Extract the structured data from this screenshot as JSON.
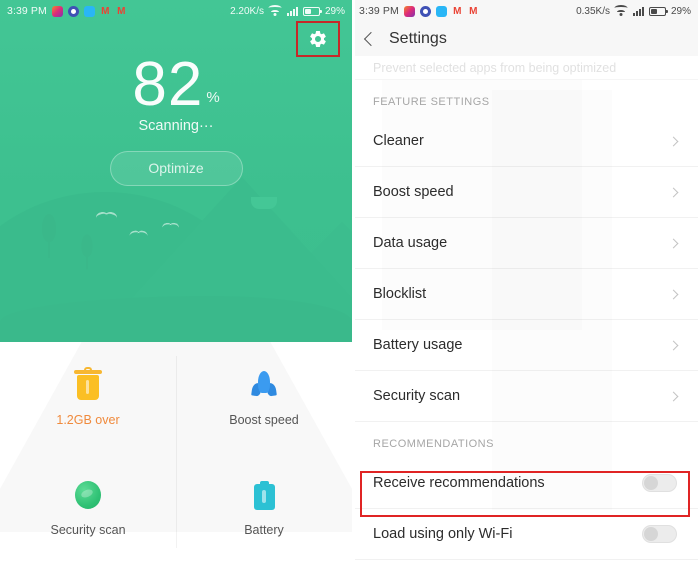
{
  "left": {
    "statusbar": {
      "time": "3:39 PM",
      "net_speed": "2.20K/s",
      "battery_pct": "29%",
      "icons": [
        "instagram-icon",
        "camera-icon",
        "app-icon",
        "gmail-icon",
        "gmail-icon"
      ]
    },
    "gear_label": "gear-icon",
    "score": {
      "value": "82",
      "unit": "%",
      "status": "Scanning···"
    },
    "optimize_label": "Optimize",
    "features": [
      {
        "label": "1.2GB over",
        "icon": "trash-icon"
      },
      {
        "label": "Boost speed",
        "icon": "rocket-icon"
      },
      {
        "label": "Security scan",
        "icon": "shield-icon"
      },
      {
        "label": "Battery",
        "icon": "battery-icon"
      }
    ]
  },
  "right": {
    "statusbar": {
      "time": "3:39 PM",
      "net_speed": "0.35K/s",
      "battery_pct": "29%"
    },
    "header": {
      "title": "Settings",
      "back": "back-icon"
    },
    "faded_row": "Prevent selected apps from being optimized",
    "section_feature": "FEATURE SETTINGS",
    "feature_items": [
      {
        "label": "Cleaner"
      },
      {
        "label": "Boost speed"
      },
      {
        "label": "Data usage"
      },
      {
        "label": "Blocklist"
      },
      {
        "label": "Battery usage"
      },
      {
        "label": "Security scan"
      }
    ],
    "section_recommend": "RECOMMENDATIONS",
    "recommend_items": [
      {
        "label": "Receive recommendations",
        "toggle": "off"
      },
      {
        "label": "Load using only Wi-Fi",
        "toggle": "off"
      }
    ]
  },
  "colors": {
    "green": "#3dc08f",
    "highlight_red": "#e02424",
    "accent_orange": "#f08a3c"
  }
}
